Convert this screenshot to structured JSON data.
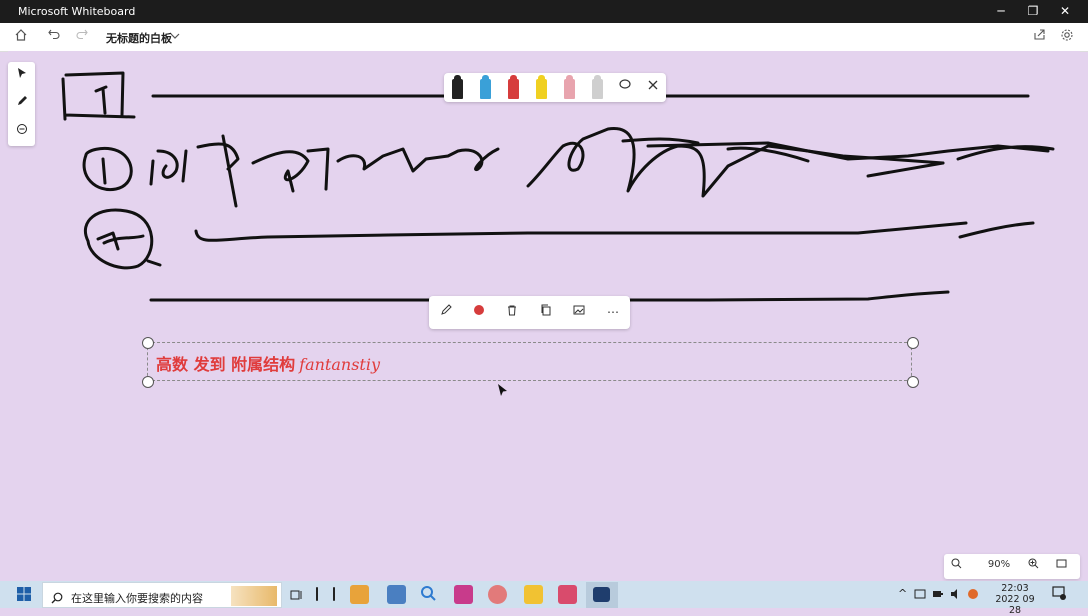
{
  "window": {
    "title": "Microsoft Whiteboard",
    "minimize_glyph": "─",
    "restore_glyph": "❐",
    "close_glyph": "✕"
  },
  "appbar": {
    "board_title": "无标题的白板",
    "home_icon": "home-icon",
    "undo_icon": "undo-icon",
    "redo_icon": "redo-icon",
    "share_icon": "share-icon",
    "settings_icon": "gear-icon"
  },
  "left_tools": [
    "select-arrow-icon",
    "pen-icon",
    "eraser-icon"
  ],
  "pen_colors": [
    "#222222",
    "#3aa0d8",
    "#d63c3c",
    "#f0d021",
    "#e8a4ae"
  ],
  "note": {
    "text": "高数 发到 附属结构",
    "script": "fantanstiy",
    "color": "#e03c3c"
  },
  "zoom": {
    "value": "90%"
  },
  "taskbar": {
    "search_placeholder": "在这里输入你要搜索的内容",
    "app_colors": [
      "#e8a33a",
      "#4a7fc1",
      "#2e7bd0",
      "#c83b8b",
      "#e27a7a",
      "#f1c232",
      "#d94b6c",
      "#1f3d6d"
    ],
    "clock_time": "22:03",
    "clock_date": "2022 09 28"
  }
}
